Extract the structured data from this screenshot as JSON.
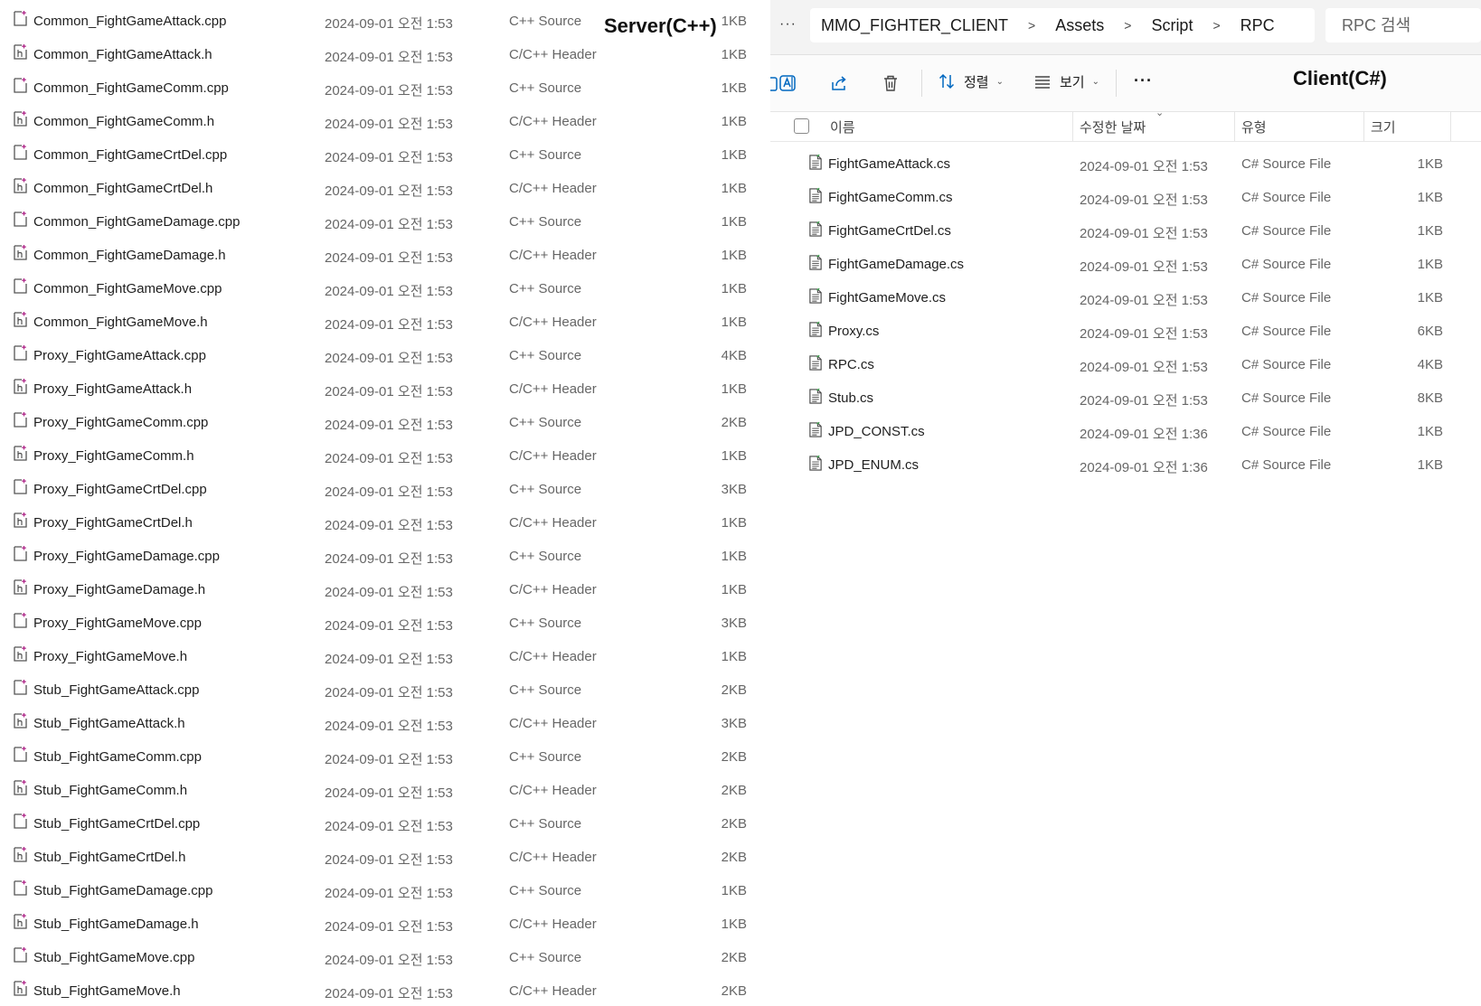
{
  "server": {
    "label": "Server(C++)",
    "files": [
      {
        "name": "Common_FightGameAttack.cpp",
        "date": "2024-09-01 오전 1:53",
        "type": "C++ Source",
        "size": "1KB",
        "kind": "cpp"
      },
      {
        "name": "Common_FightGameAttack.h",
        "date": "2024-09-01 오전 1:53",
        "type": "C/C++ Header",
        "size": "1KB",
        "kind": "h"
      },
      {
        "name": "Common_FightGameComm.cpp",
        "date": "2024-09-01 오전 1:53",
        "type": "C++ Source",
        "size": "1KB",
        "kind": "cpp"
      },
      {
        "name": "Common_FightGameComm.h",
        "date": "2024-09-01 오전 1:53",
        "type": "C/C++ Header",
        "size": "1KB",
        "kind": "h"
      },
      {
        "name": "Common_FightGameCrtDel.cpp",
        "date": "2024-09-01 오전 1:53",
        "type": "C++ Source",
        "size": "1KB",
        "kind": "cpp"
      },
      {
        "name": "Common_FightGameCrtDel.h",
        "date": "2024-09-01 오전 1:53",
        "type": "C/C++ Header",
        "size": "1KB",
        "kind": "h"
      },
      {
        "name": "Common_FightGameDamage.cpp",
        "date": "2024-09-01 오전 1:53",
        "type": "C++ Source",
        "size": "1KB",
        "kind": "cpp"
      },
      {
        "name": "Common_FightGameDamage.h",
        "date": "2024-09-01 오전 1:53",
        "type": "C/C++ Header",
        "size": "1KB",
        "kind": "h"
      },
      {
        "name": "Common_FightGameMove.cpp",
        "date": "2024-09-01 오전 1:53",
        "type": "C++ Source",
        "size": "1KB",
        "kind": "cpp"
      },
      {
        "name": "Common_FightGameMove.h",
        "date": "2024-09-01 오전 1:53",
        "type": "C/C++ Header",
        "size": "1KB",
        "kind": "h"
      },
      {
        "name": "Proxy_FightGameAttack.cpp",
        "date": "2024-09-01 오전 1:53",
        "type": "C++ Source",
        "size": "4KB",
        "kind": "cpp"
      },
      {
        "name": "Proxy_FightGameAttack.h",
        "date": "2024-09-01 오전 1:53",
        "type": "C/C++ Header",
        "size": "1KB",
        "kind": "h"
      },
      {
        "name": "Proxy_FightGameComm.cpp",
        "date": "2024-09-01 오전 1:53",
        "type": "C++ Source",
        "size": "2KB",
        "kind": "cpp"
      },
      {
        "name": "Proxy_FightGameComm.h",
        "date": "2024-09-01 오전 1:53",
        "type": "C/C++ Header",
        "size": "1KB",
        "kind": "h"
      },
      {
        "name": "Proxy_FightGameCrtDel.cpp",
        "date": "2024-09-01 오전 1:53",
        "type": "C++ Source",
        "size": "3KB",
        "kind": "cpp"
      },
      {
        "name": "Proxy_FightGameCrtDel.h",
        "date": "2024-09-01 오전 1:53",
        "type": "C/C++ Header",
        "size": "1KB",
        "kind": "h"
      },
      {
        "name": "Proxy_FightGameDamage.cpp",
        "date": "2024-09-01 오전 1:53",
        "type": "C++ Source",
        "size": "1KB",
        "kind": "cpp"
      },
      {
        "name": "Proxy_FightGameDamage.h",
        "date": "2024-09-01 오전 1:53",
        "type": "C/C++ Header",
        "size": "1KB",
        "kind": "h"
      },
      {
        "name": "Proxy_FightGameMove.cpp",
        "date": "2024-09-01 오전 1:53",
        "type": "C++ Source",
        "size": "3KB",
        "kind": "cpp"
      },
      {
        "name": "Proxy_FightGameMove.h",
        "date": "2024-09-01 오전 1:53",
        "type": "C/C++ Header",
        "size": "1KB",
        "kind": "h"
      },
      {
        "name": "Stub_FightGameAttack.cpp",
        "date": "2024-09-01 오전 1:53",
        "type": "C++ Source",
        "size": "2KB",
        "kind": "cpp"
      },
      {
        "name": "Stub_FightGameAttack.h",
        "date": "2024-09-01 오전 1:53",
        "type": "C/C++ Header",
        "size": "3KB",
        "kind": "h"
      },
      {
        "name": "Stub_FightGameComm.cpp",
        "date": "2024-09-01 오전 1:53",
        "type": "C++ Source",
        "size": "2KB",
        "kind": "cpp"
      },
      {
        "name": "Stub_FightGameComm.h",
        "date": "2024-09-01 오전 1:53",
        "type": "C/C++ Header",
        "size": "2KB",
        "kind": "h"
      },
      {
        "name": "Stub_FightGameCrtDel.cpp",
        "date": "2024-09-01 오전 1:53",
        "type": "C++ Source",
        "size": "2KB",
        "kind": "cpp"
      },
      {
        "name": "Stub_FightGameCrtDel.h",
        "date": "2024-09-01 오전 1:53",
        "type": "C/C++ Header",
        "size": "2KB",
        "kind": "h"
      },
      {
        "name": "Stub_FightGameDamage.cpp",
        "date": "2024-09-01 오전 1:53",
        "type": "C++ Source",
        "size": "1KB",
        "kind": "cpp"
      },
      {
        "name": "Stub_FightGameDamage.h",
        "date": "2024-09-01 오전 1:53",
        "type": "C/C++ Header",
        "size": "1KB",
        "kind": "h"
      },
      {
        "name": "Stub_FightGameMove.cpp",
        "date": "2024-09-01 오전 1:53",
        "type": "C++ Source",
        "size": "2KB",
        "kind": "cpp"
      },
      {
        "name": "Stub_FightGameMove.h",
        "date": "2024-09-01 오전 1:53",
        "type": "C/C++ Header",
        "size": "2KB",
        "kind": "h"
      }
    ]
  },
  "client": {
    "label": "Client(C#)",
    "more_path": "···",
    "breadcrumb": [
      "MMO_FIGHTER_CLIENT",
      "Assets",
      "Script",
      "RPC"
    ],
    "search_placeholder": "RPC 검색",
    "toolbar": {
      "sort_label": "정렬",
      "view_label": "보기",
      "more_label": "···",
      "icons": [
        "copy-icon",
        "rename-icon",
        "share-icon",
        "delete-icon",
        "sort-icon",
        "view-icon"
      ]
    },
    "columns": {
      "name": "이름",
      "date": "수정한 날짜",
      "type": "유형",
      "size": "크기"
    },
    "files": [
      {
        "name": "FightGameAttack.cs",
        "date": "2024-09-01 오전 1:53",
        "type": "C# Source File",
        "size": "1KB"
      },
      {
        "name": "FightGameComm.cs",
        "date": "2024-09-01 오전 1:53",
        "type": "C# Source File",
        "size": "1KB"
      },
      {
        "name": "FightGameCrtDel.cs",
        "date": "2024-09-01 오전 1:53",
        "type": "C# Source File",
        "size": "1KB"
      },
      {
        "name": "FightGameDamage.cs",
        "date": "2024-09-01 오전 1:53",
        "type": "C# Source File",
        "size": "1KB"
      },
      {
        "name": "FightGameMove.cs",
        "date": "2024-09-01 오전 1:53",
        "type": "C# Source File",
        "size": "1KB"
      },
      {
        "name": "Proxy.cs",
        "date": "2024-09-01 오전 1:53",
        "type": "C# Source File",
        "size": "6KB"
      },
      {
        "name": "RPC.cs",
        "date": "2024-09-01 오전 1:53",
        "type": "C# Source File",
        "size": "4KB"
      },
      {
        "name": "Stub.cs",
        "date": "2024-09-01 오전 1:53",
        "type": "C# Source File",
        "size": "8KB"
      },
      {
        "name": "JPD_CONST.cs",
        "date": "2024-09-01 오전 1:36",
        "type": "C# Source File",
        "size": "1KB"
      },
      {
        "name": "JPD_ENUM.cs",
        "date": "2024-09-01 오전 1:36",
        "type": "C# Source File",
        "size": "1KB"
      }
    ]
  },
  "colors": {
    "accent": "#0067c0",
    "text_secondary": "#666666",
    "icon_badge": "#b02a8a"
  }
}
